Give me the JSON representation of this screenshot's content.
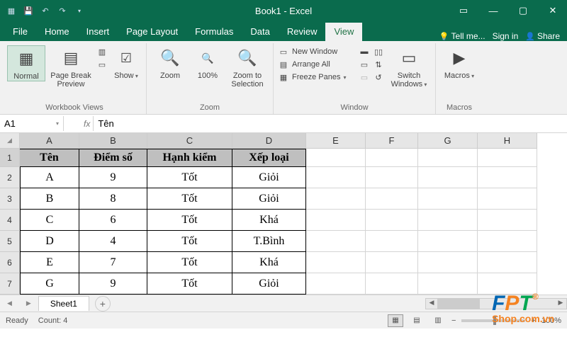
{
  "title": "Book1 - Excel",
  "tabs": {
    "file": "File",
    "home": "Home",
    "insert": "Insert",
    "page_layout": "Page Layout",
    "formulas": "Formulas",
    "data": "Data",
    "review": "Review",
    "view": "View",
    "tell_me": "Tell me...",
    "sign_in": "Sign in",
    "share": "Share"
  },
  "ribbon": {
    "views": {
      "normal": "Normal",
      "page_break": "Page Break Preview",
      "show": "Show",
      "label": "Workbook Views"
    },
    "zoom": {
      "zoom": "Zoom",
      "p100": "100%",
      "to_sel": "Zoom to Selection",
      "label": "Zoom"
    },
    "window": {
      "new": "New Window",
      "arrange": "Arrange All",
      "freeze": "Freeze Panes",
      "switch": "Switch Windows",
      "label": "Window"
    },
    "macros": {
      "macros": "Macros",
      "label": "Macros"
    }
  },
  "namebox": "A1",
  "formula": "Tên",
  "cols": [
    "A",
    "B",
    "C",
    "D",
    "E",
    "F",
    "G",
    "H"
  ],
  "hdr": [
    "Tên",
    "Điểm số",
    "Hạnh kiểm",
    "Xếp loại"
  ],
  "rows": [
    [
      "A",
      "9",
      "Tốt",
      "Giỏi"
    ],
    [
      "B",
      "8",
      "Tốt",
      "Giỏi"
    ],
    [
      "C",
      "6",
      "Tốt",
      "Khá"
    ],
    [
      "D",
      "4",
      "Tốt",
      "T.Bình"
    ],
    [
      "E",
      "7",
      "Tốt",
      "Khá"
    ],
    [
      "G",
      "9",
      "Tốt",
      "Giỏi"
    ]
  ],
  "sheet": "Sheet1",
  "status": {
    "ready": "Ready",
    "count": "Count: 4",
    "zoom": "100%"
  },
  "logo": {
    "f": "F",
    "p": "P",
    "t": "T",
    "sub": "Shop.com.vn",
    "reg": "®"
  }
}
